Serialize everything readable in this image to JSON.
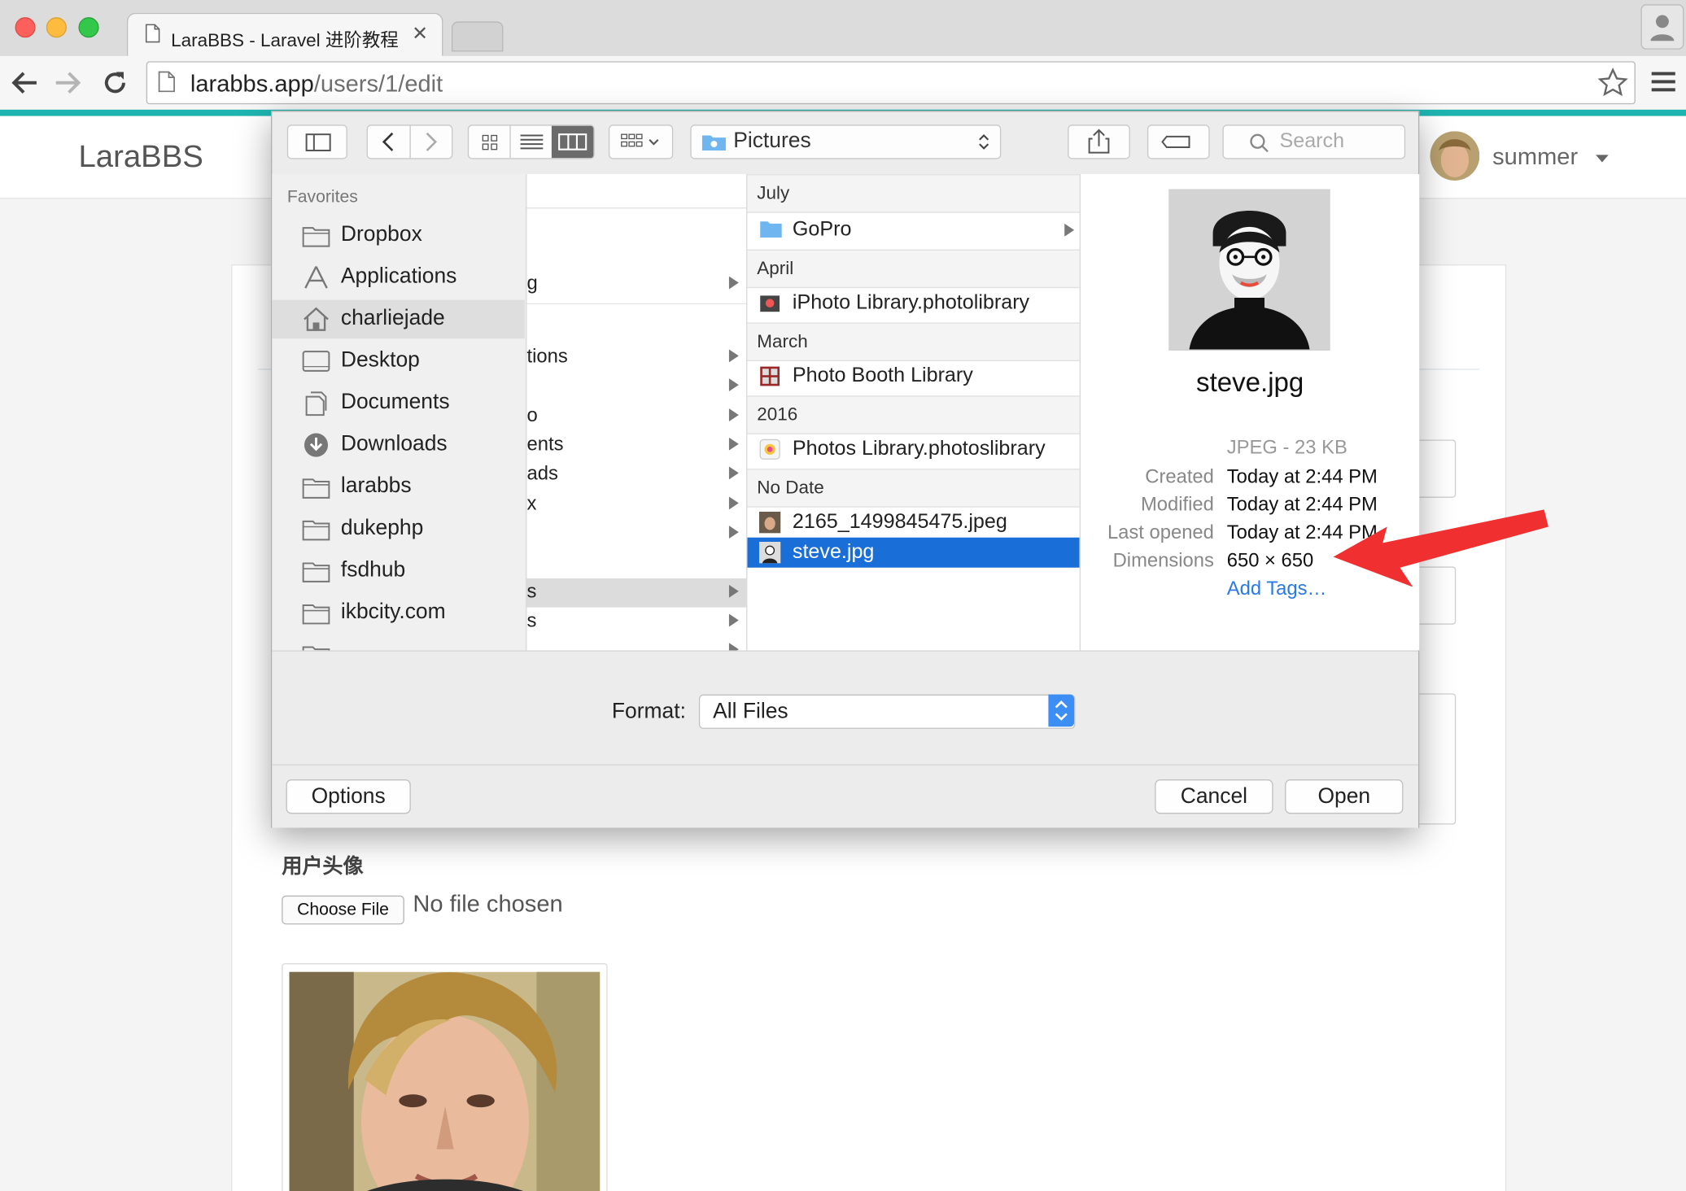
{
  "browser": {
    "tab_title": "LaraBBS - Laravel 进阶教程",
    "url_host": "larabbs.app",
    "url_path": "/users/1/edit"
  },
  "site": {
    "brand": "LaraBBS",
    "username": "summer"
  },
  "form": {
    "avatar_label": "用户头像",
    "choose_file_label": "Choose File",
    "no_file_text": "No file chosen"
  },
  "dialog": {
    "location": "Pictures",
    "search_placeholder": "Search",
    "sidebar_heading": "Favorites",
    "sidebar_items": [
      {
        "label": "Dropbox",
        "icon": "folder-icon"
      },
      {
        "label": "Applications",
        "icon": "applications-icon"
      },
      {
        "label": "charliejade",
        "icon": "home-icon"
      },
      {
        "label": "Desktop",
        "icon": "desktop-icon"
      },
      {
        "label": "Documents",
        "icon": "documents-icon"
      },
      {
        "label": "Downloads",
        "icon": "downloads-icon"
      },
      {
        "label": "larabbs",
        "icon": "folder-icon"
      },
      {
        "label": "dukephp",
        "icon": "folder-icon"
      },
      {
        "label": "fsdhub",
        "icon": "folder-icon"
      },
      {
        "label": "ikbcity.com",
        "icon": "folder-icon"
      }
    ],
    "column1_items": [
      "g",
      "tions",
      "o",
      "ents",
      "ads",
      "x",
      "s",
      "s"
    ],
    "groups": {
      "july": "July",
      "april": "April",
      "march": "March",
      "y2016": "2016",
      "nodate": "No Date"
    },
    "files": {
      "gopro": "GoPro",
      "iphoto": "iPhoto Library.photolibrary",
      "photobooth": "Photo Booth Library",
      "photos": "Photos Library.photoslibrary",
      "jpeg2165": "2165_1499845475.jpeg",
      "steve": "steve.jpg"
    },
    "preview": {
      "filename": "steve.jpg",
      "kind": "JPEG - 23 KB",
      "created_label": "Created",
      "created_value": "Today at 2:44 PM",
      "modified_label": "Modified",
      "modified_value": "Today at 2:44 PM",
      "opened_label": "Last opened",
      "opened_value": "Today at 2:44 PM",
      "dimensions_label": "Dimensions",
      "dimensions_value": "650 × 650",
      "add_tags": "Add Tags…"
    },
    "format_label": "Format:",
    "format_value": "All Files",
    "options_label": "Options",
    "cancel_label": "Cancel",
    "open_label": "Open"
  },
  "colors": {
    "accent": "#1fb4b0",
    "selection": "#1a6ed8",
    "arrow": "#f03030"
  }
}
